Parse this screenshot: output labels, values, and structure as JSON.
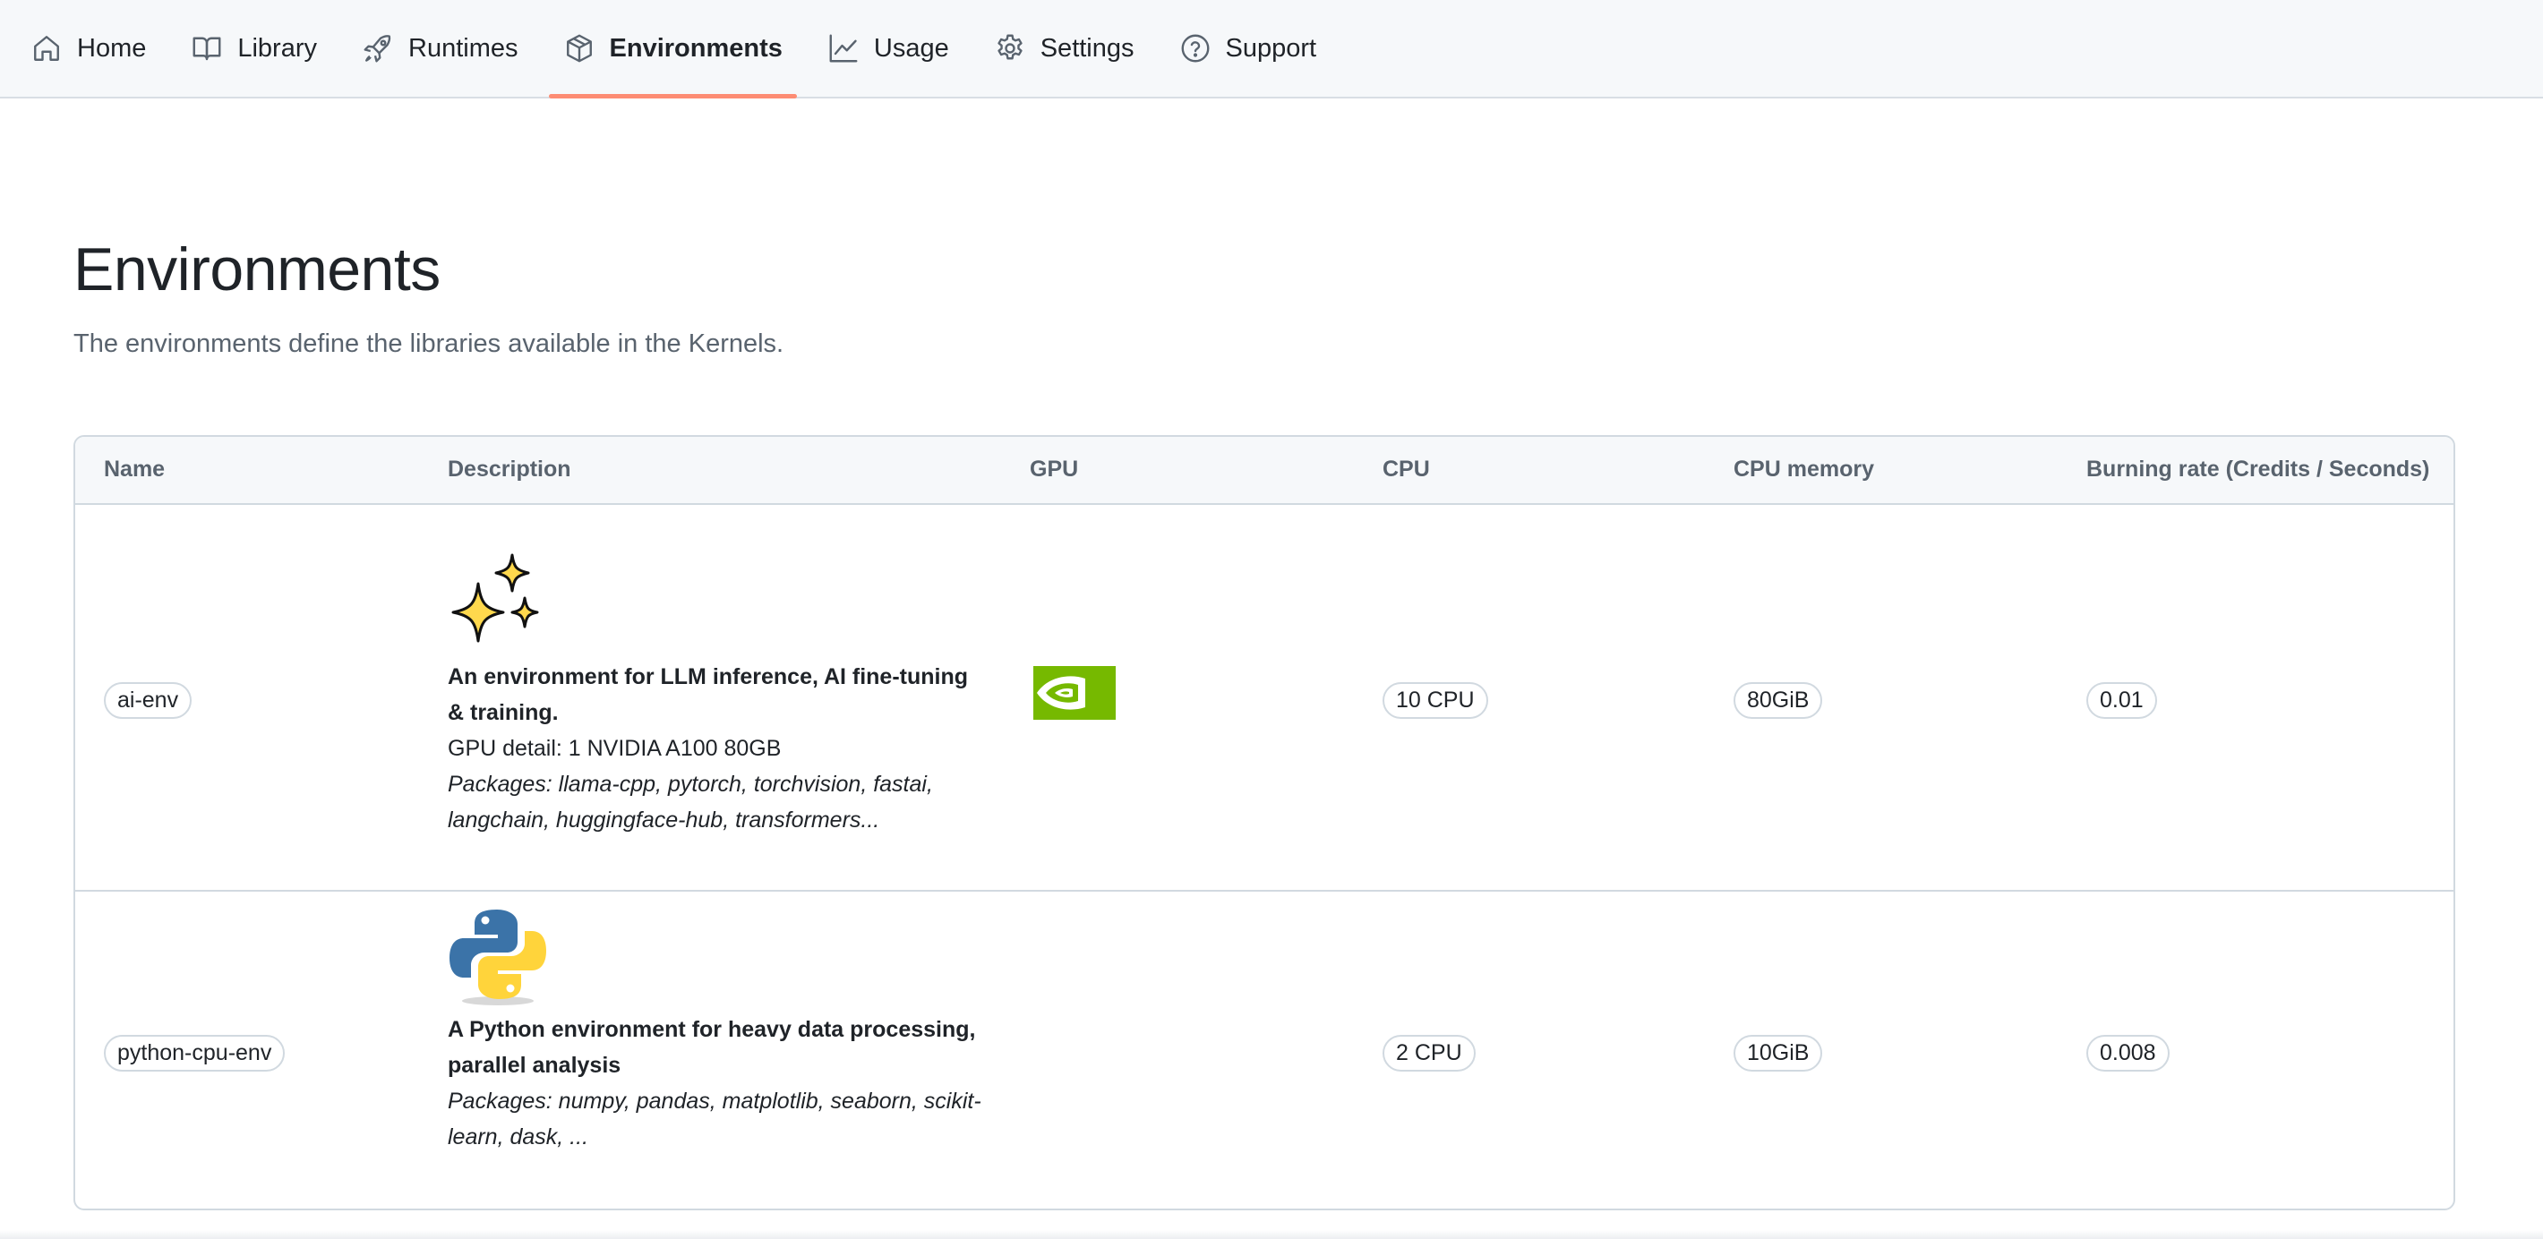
{
  "nav": {
    "items": [
      {
        "label": "Home",
        "icon": "home-icon",
        "active": false
      },
      {
        "label": "Library",
        "icon": "book-icon",
        "active": false
      },
      {
        "label": "Runtimes",
        "icon": "rocket-icon",
        "active": false
      },
      {
        "label": "Environments",
        "icon": "package-icon",
        "active": true
      },
      {
        "label": "Usage",
        "icon": "graph-icon",
        "active": false
      },
      {
        "label": "Settings",
        "icon": "gear-icon",
        "active": false
      },
      {
        "label": "Support",
        "icon": "question-icon",
        "active": false
      }
    ],
    "active_underline_color": "#fd8c73"
  },
  "page": {
    "title": "Environments",
    "subtitle": "The environments define the libraries available in the Kernels."
  },
  "table": {
    "columns": [
      "Name",
      "Description",
      "GPU",
      "CPU",
      "CPU memory",
      "Burning rate (Credits / Seconds)"
    ],
    "rows": [
      {
        "name": "ai-env",
        "icon": "sparkles-icon",
        "title": "An environment for LLM inference, AI fine-tuning & training.",
        "gpu_detail": "GPU detail: 1 NVIDIA A100 80GB",
        "packages": "Packages: llama-cpp, pytorch, torchvision, fastai, langchain, huggingface-hub, transformers...",
        "gpu_icon": "nvidia-logo-icon",
        "cpu": "10 CPU",
        "memory": "80GiB",
        "rate": "0.01"
      },
      {
        "name": "python-cpu-env",
        "icon": "python-logo-icon",
        "title": "A Python environment for heavy data processing, parallel analysis",
        "packages": "Packages: numpy, pandas, matplotlib, seaborn, scikit-learn, dask, ...",
        "cpu": "2 CPU",
        "memory": "10GiB",
        "rate": "0.008"
      }
    ]
  },
  "colors": {
    "nvidia_green": "#76b900",
    "python_blue": "#3b73a8",
    "python_yellow": "#ffd43b",
    "sparkle_yellow": "#ffd84d"
  }
}
